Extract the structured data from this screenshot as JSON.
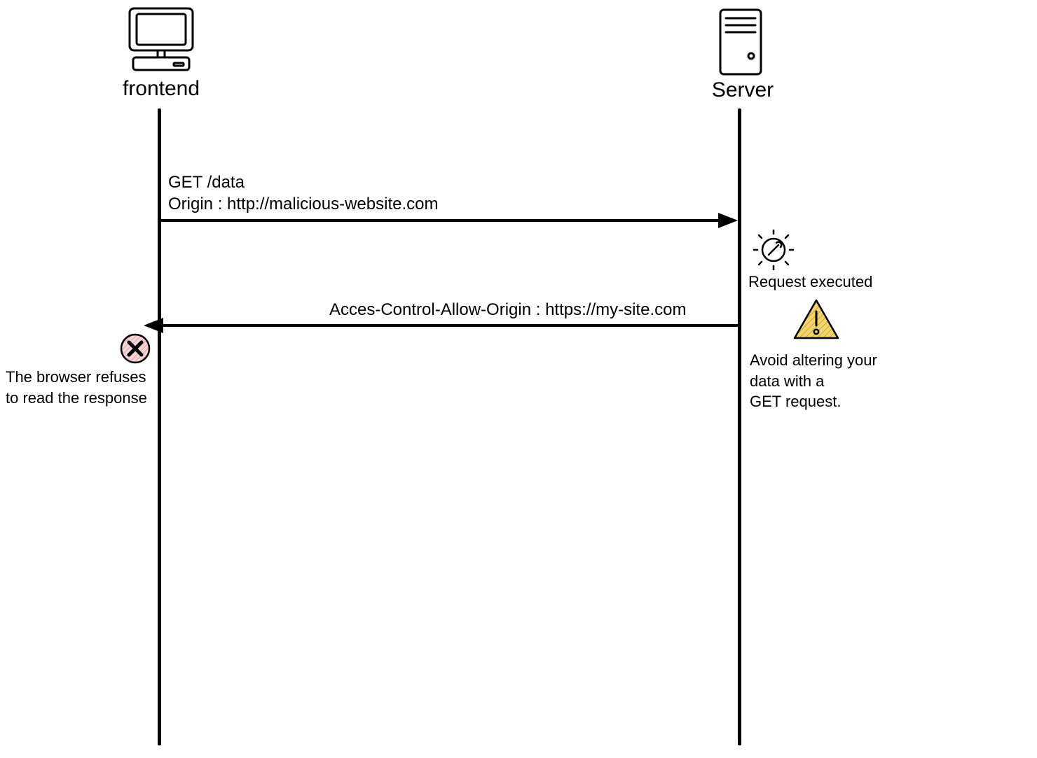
{
  "actors": {
    "frontend": {
      "label": "frontend"
    },
    "server": {
      "label": "Server"
    }
  },
  "messages": {
    "request": {
      "line1": "GET /data",
      "line2": "Origin : http://malicious-website.com"
    },
    "response": {
      "line1": "Acces-Control-Allow-Origin : https://my-site.com"
    }
  },
  "notes": {
    "executed": "Request executed",
    "warning": "Avoid altering your\ndata with a\nGET request.",
    "refused": "The browser refuses\nto read the response"
  }
}
